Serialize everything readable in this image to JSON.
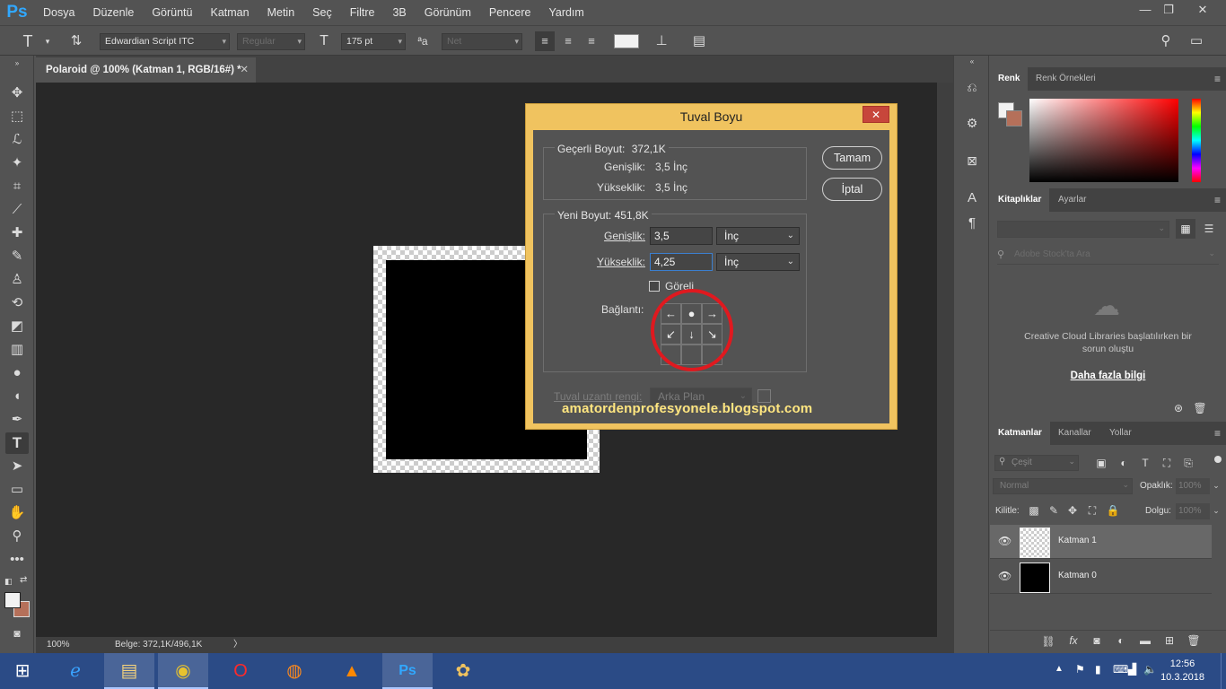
{
  "app": {
    "logo": "Ps"
  },
  "menu": [
    "Dosya",
    "Düzenle",
    "Görüntü",
    "Katman",
    "Metin",
    "Seç",
    "Filtre",
    "3B",
    "Görünüm",
    "Pencere",
    "Yardım"
  ],
  "window_controls": {
    "minimize": "—",
    "restore": "❐",
    "close": "✕"
  },
  "options_bar": {
    "tool_icon": "T",
    "font_family": "Edwardian Script ITC",
    "font_style": "Regular",
    "font_size": "175 pt",
    "antialias": "Net",
    "aa_label": "ªa"
  },
  "document": {
    "tab_title": "Polaroid @ 100% (Katman 1, RGB/16#) *",
    "tab_close": "✕",
    "zoom": "100%",
    "doc_info": "Belge: 372,1K/496,1K",
    "doc_info_arrow": "〉"
  },
  "dialog": {
    "title": "Tuval Boyu",
    "close": "✕",
    "current_size_label": "Geçerli Boyut:",
    "current_size_value": "372,1K",
    "current_width_label": "Genişlik:",
    "current_width_value": "3,5 İnç",
    "current_height_label": "Yükseklik:",
    "current_height_value": "3,5 İnç",
    "new_size_label": "Yeni Boyut: 451,8K",
    "width_label": "Genişlik:",
    "width_value": "3,5",
    "width_unit": "İnç",
    "height_label": "Yükseklik:",
    "height_value": "4,25",
    "height_unit": "İnç",
    "relative_label": "Göreli",
    "anchor_label": "Bağlantı:",
    "extension_color_label": "Tuval uzantı rengi:",
    "extension_color_value": "Arka Plan",
    "ok_button": "Tamam",
    "cancel_button": "İptal"
  },
  "watermark": "amatordenprofesyonele.blogspot.com",
  "panels": {
    "color_tabs": [
      "Renk",
      "Renk Örnekleri"
    ],
    "library_tabs": [
      "Kitaplıklar",
      "Ayarlar"
    ],
    "library_search_placeholder": "Adobe Stock'ta Ara",
    "library_error": "Creative Cloud Libraries başlatılırken bir sorun oluştu",
    "library_more_link": "Daha fazla bilgi",
    "layers_tabs": [
      "Katmanlar",
      "Kanallar",
      "Yollar"
    ],
    "layers_filter": "Çeşit",
    "blend_mode": "Normal",
    "opacity_label": "Opaklık:",
    "opacity_value": "100%",
    "lock_label": "Kilitle:",
    "fill_label": "Dolgu:",
    "fill_value": "100%",
    "layers": [
      {
        "name": "Katman 1",
        "selected": true,
        "thumb": "transparent"
      },
      {
        "name": "Katman 0",
        "selected": false,
        "thumb": "black"
      }
    ]
  },
  "taskbar": {
    "time": "12:56",
    "date": "10.3.2018"
  },
  "colors": {
    "dialog_frame": "#f0c35f",
    "anchor_highlight": "#e0191f",
    "watermark": "#ffe680",
    "taskbar": "#2b4b86"
  }
}
